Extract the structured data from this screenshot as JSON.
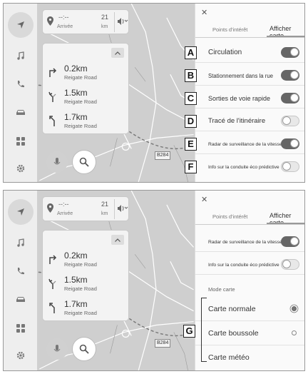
{
  "colors": {
    "map_bg": "#cfcfcf",
    "settings_bg": "#fafafa",
    "toggle_on": "#666666",
    "toggle_off": "#e8e8e8"
  },
  "icons": {
    "sidebar": [
      "navigation-arrow-icon",
      "music-note-icon",
      "phone-icon",
      "car-icon",
      "apps-grid-icon",
      "gear-icon"
    ],
    "turns": [
      "turn-right-icon",
      "keep-left-icon",
      "turn-left-icon"
    ]
  },
  "nav": {
    "arrival_time": "--:--",
    "arrival_label": "Arrivée",
    "distance_value": "21",
    "distance_unit": "km",
    "turns": [
      {
        "distance": "0.2km",
        "road": "Reigate Road"
      },
      {
        "distance": "1.5km",
        "road": "Reigate Road"
      },
      {
        "distance": "1.7km",
        "road": "Reigate Road"
      }
    ],
    "road_label": "B284"
  },
  "panel1": {
    "tabs": {
      "poi": "Points d'intérêt",
      "show_map": "Afficher carte"
    },
    "rows": [
      {
        "callout": "A",
        "label": "Circulation",
        "on": true
      },
      {
        "callout": "B",
        "label": "Stationnement dans la rue",
        "on": true
      },
      {
        "callout": "C",
        "label": "Sorties de voie rapide",
        "on": true
      },
      {
        "callout": "D",
        "label": "Tracé de l'itinéraire",
        "on": false
      },
      {
        "callout": "E",
        "label": "Radar de surveillance de la vitesse",
        "on": true
      },
      {
        "callout": "F",
        "label": "Info sur la conduite éco prédictive",
        "on": false
      }
    ]
  },
  "panel2": {
    "tabs": {
      "poi": "Points d'intérêt",
      "show_map": "Afficher carte"
    },
    "rows": [
      {
        "label": "Radar de surveillance de la vitesse",
        "on": true
      },
      {
        "label": "Info sur la conduite éco prédictive",
        "on": false
      }
    ],
    "mode_header": "Mode carte",
    "modes": [
      {
        "label": "Carte normale",
        "selected": true
      },
      {
        "label": "Carte boussole",
        "selected": false
      },
      {
        "label": "Carte météo",
        "selected": false
      }
    ],
    "callout": "G"
  }
}
